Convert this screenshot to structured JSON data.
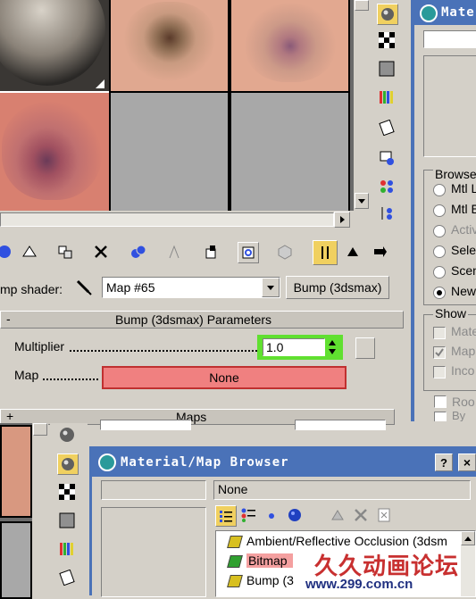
{
  "material_editor": {
    "shader_label": "mp shader:",
    "map_name": "Map #65",
    "map_type_button": "Bump (3dsmax)",
    "rollout_title": "Bump (3dsmax) Parameters",
    "rollout_collapse": "-",
    "multiplier_label": "Multiplier",
    "multiplier_value": "1.0",
    "map_label": "Map",
    "map_button": "None",
    "maps_rollout_title": "Maps",
    "maps_rollout_toggle": "+"
  },
  "browser_top": {
    "title": "Material/Map Browser",
    "browse_group": "Browse",
    "browse_options": [
      "Mtl L",
      "Mtl E",
      "Activ",
      "Sele",
      "Scen",
      "New"
    ],
    "browse_selected": "New",
    "show_group": "Show",
    "show_options": [
      "Mate",
      "Map",
      "Inco"
    ],
    "show_checked": "Map",
    "root_option": "Roo",
    "by_option": "By"
  },
  "browser": {
    "title": "Material/Map Browser",
    "help_button": "?",
    "close_button": "×",
    "search_value": "",
    "current_value": "None",
    "items": [
      {
        "label": "Ambient/Reflective Occlusion (3dsm",
        "icon_color": "#d8c020"
      },
      {
        "label": "Bitmap",
        "icon_color": "#30a030"
      },
      {
        "label": "Bump (3",
        "icon_color": "#d8c020"
      }
    ],
    "selected_item": "Bitmap"
  },
  "watermark": {
    "line1": "久久动画论坛",
    "line2": "www.299.com.cn"
  }
}
